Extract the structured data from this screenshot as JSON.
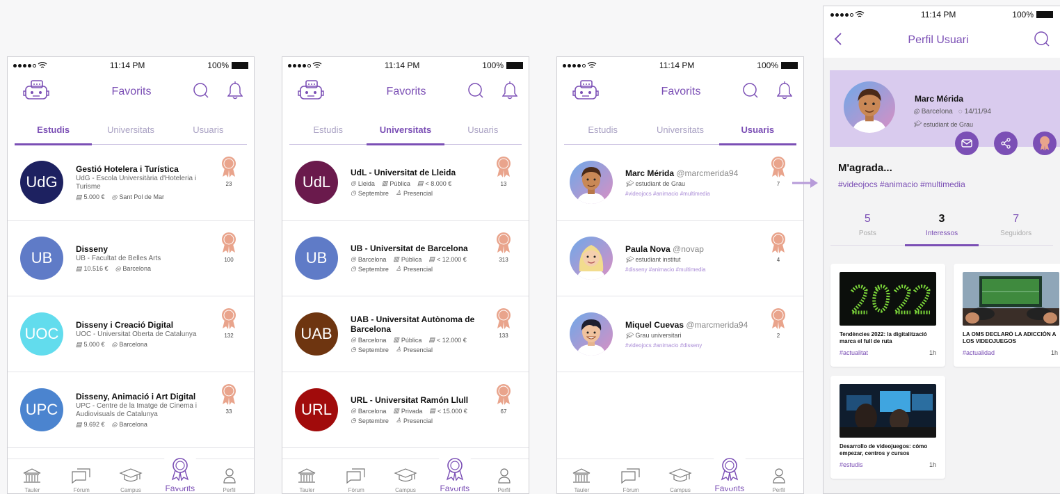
{
  "status": {
    "time": "11:14 PM",
    "battery": "100%"
  },
  "favorits_header": {
    "title": "Favorits"
  },
  "tabs": [
    "Estudis",
    "Universitats",
    "Usuaris"
  ],
  "studies": [
    {
      "logo": "UdG",
      "color": "#1d2160",
      "title": "Gestió Hotelera i Turística",
      "sub": "UdG - Escola Universitària d'Hoteleria i Turisme",
      "price": "5.000 €",
      "place": "Sant Pol de Mar",
      "count": "23"
    },
    {
      "logo": "UB",
      "color": "#5f7bc7",
      "title": "Disseny",
      "sub": "UB - Facultat de Belles Arts",
      "price": "10.516 €",
      "place": "Barcelona",
      "count": "100"
    },
    {
      "logo": "UOC",
      "color": "#62dced",
      "title": "Disseny i Creació Digital",
      "sub": "UOC - Universitat Oberta de Catalunya",
      "price": "5.000 €",
      "place": "Barcelona",
      "count": "132"
    },
    {
      "logo": "UPC",
      "color": "#4b84cf",
      "title": "Disseny, Animació i Art Digital",
      "sub": "UPC - Centre de la Imatge de Cinema i Audiovisuals de Catalunya",
      "price": "9.692 €",
      "place": "Barcelona",
      "count": "33"
    }
  ],
  "universities": [
    {
      "logo": "UdL",
      "color": "#6a1a4c",
      "title": "UdL - Universitat de Lleida",
      "place": "Lleida",
      "kind": "Pública",
      "price": "< 8.000 €",
      "month": "Septembre",
      "mode": "Presencial",
      "count": "13"
    },
    {
      "logo": "UB",
      "color": "#5f7bc7",
      "title": "UB - Universitat de Barcelona",
      "place": "Barcelona",
      "kind": "Pública",
      "price": "< 12.000 €",
      "month": "Septembre",
      "mode": "Presencial",
      "count": "313"
    },
    {
      "logo": "UAB",
      "color": "#6e3510",
      "title": "UAB - Universitat Autònoma de Barcelona",
      "place": "Barcelona",
      "kind": "Pública",
      "price": "< 12.000 €",
      "month": "Septembre",
      "mode": "Presencial",
      "count": "133"
    },
    {
      "logo": "URL",
      "color": "#a10b0b",
      "title": "URL - Universitat Ramón Llull",
      "place": "Barcelona",
      "kind": "Privada",
      "price": "< 15.000 €",
      "month": "Septembre",
      "mode": "Presencial",
      "count": "67"
    }
  ],
  "users": [
    {
      "name": "Marc Mérida",
      "handle": "@marcmerida94",
      "role": "estudiant de Grau",
      "tags": "#videojocs  #animacio  #multimedia",
      "count": "7"
    },
    {
      "name": "Paula Nova",
      "handle": "@novap",
      "role": "estudiant institut",
      "tags": "#disseny  #animacio  #multimedia",
      "count": "4"
    },
    {
      "name": "Miquel Cuevas",
      "handle": "@marcmerida94",
      "role": "Grau universitari",
      "tags": "#videojocs  #animacio  #disseny",
      "count": "2"
    }
  ],
  "bottom_nav": [
    "Tauler",
    "Fòrum",
    "Campus",
    "Favorits",
    "Perfil"
  ],
  "profile": {
    "header_title": "Perfil Usuari",
    "name": "Marc Mérida",
    "city": "Barcelona",
    "birth": "14/11/94",
    "role": "estudiant de Grau",
    "likes_title": "M'agrada...",
    "hashtags": "#videojocs  #animacio  #multimedia",
    "stats": [
      {
        "n": "5",
        "l": "Posts"
      },
      {
        "n": "3",
        "l": "Interessos"
      },
      {
        "n": "7",
        "l": "Seguidors"
      }
    ],
    "cards": [
      {
        "title": "Tendències 2022: la digitalització marca el full de ruta",
        "tag": "#actualitat",
        "time": "1h"
      },
      {
        "title": "LA OMS DECLARÓ LA ADICCIÓN A LOS VIDEOJUEGOS",
        "tag": "#actualidad",
        "time": "1h"
      },
      {
        "title": "Desarrollo de videojuegos: cómo empezar, centros y cursos",
        "tag": "#estudis",
        "time": "1h"
      }
    ]
  },
  "colors": {
    "accent": "#7b4fb5",
    "badge": "#e9a48c",
    "profile_card": "#d9cbee"
  }
}
